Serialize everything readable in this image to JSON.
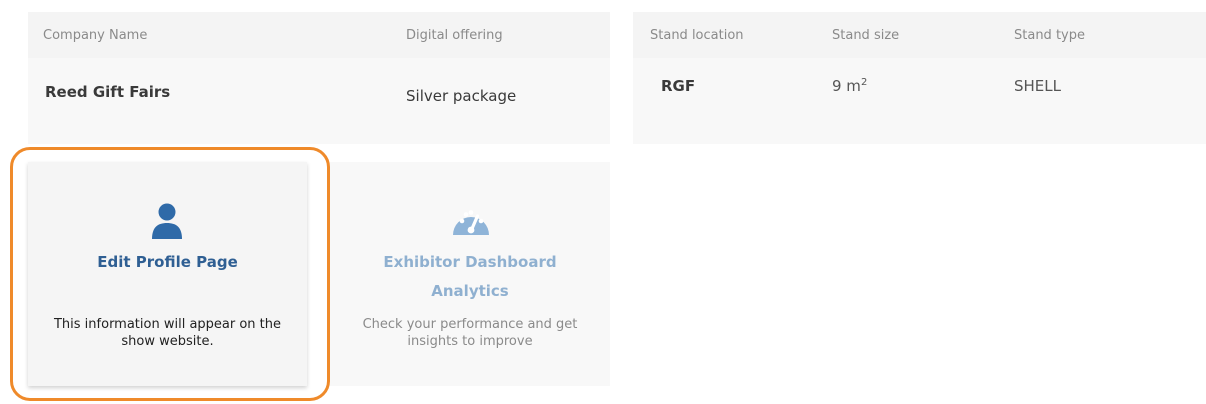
{
  "company_table": {
    "headers": {
      "company_name": "Company Name",
      "digital_offering": "Digital offering"
    },
    "row": {
      "company_name": "Reed Gift Fairs",
      "digital_offering": "Silver package"
    }
  },
  "stand_table": {
    "headers": {
      "stand_location": "Stand location",
      "stand_size": "Stand size",
      "stand_type": "Stand type"
    },
    "row": {
      "stand_location": "RGF",
      "stand_size_value": "9 m",
      "stand_size_sup": "2",
      "stand_type": "SHELL"
    }
  },
  "tiles": {
    "edit_profile": {
      "title": "Edit Profile Page",
      "description": "This information will appear on the show website.",
      "icon": "user-icon"
    },
    "analytics": {
      "title_line1": "Exhibitor Dashboard",
      "title_line2": "Analytics",
      "description": "Check your performance and get insights to improve",
      "icon": "speedometer-icon"
    }
  },
  "colors": {
    "primary": "#2f6aa8",
    "primary_muted": "#8fb4d8",
    "highlight": "#ef8a2a"
  }
}
